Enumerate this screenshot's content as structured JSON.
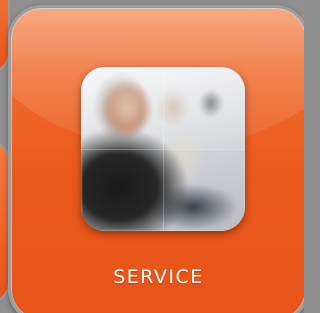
{
  "tile": {
    "label": "SERVICE",
    "image_subject": "call-center-agents-photo",
    "accent_color": "#ef5d1f",
    "border_color": "#9e9e9e"
  }
}
